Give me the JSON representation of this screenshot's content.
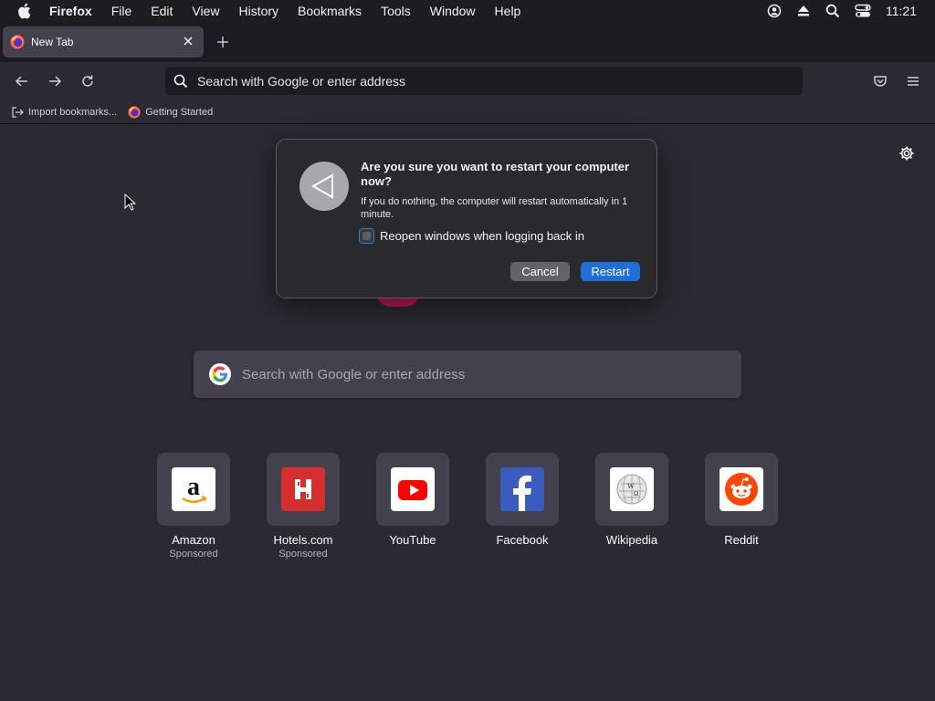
{
  "menubar": {
    "app_name": "Firefox",
    "items": [
      "File",
      "Edit",
      "View",
      "History",
      "Bookmarks",
      "Tools",
      "Window",
      "Help"
    ],
    "clock": "11:21"
  },
  "tabs": {
    "active_title": "New Tab"
  },
  "navbar": {
    "url_placeholder": "Search with Google or enter address"
  },
  "bookmarks": {
    "items": [
      "Import bookmarks...",
      "Getting Started"
    ]
  },
  "newtab": {
    "search_placeholder": "Search with Google or enter address",
    "top_sites": [
      {
        "name": "Amazon",
        "sub": "Sponsored",
        "icon": "amazon-icon"
      },
      {
        "name": "Hotels.com",
        "sub": "Sponsored",
        "icon": "hotels-icon"
      },
      {
        "name": "YouTube",
        "sub": "",
        "icon": "youtube-icon"
      },
      {
        "name": "Facebook",
        "sub": "",
        "icon": "facebook-icon"
      },
      {
        "name": "Wikipedia",
        "sub": "",
        "icon": "wikipedia-icon"
      },
      {
        "name": "Reddit",
        "sub": "",
        "icon": "reddit-icon"
      }
    ]
  },
  "dialog": {
    "title": "Are you sure you want to restart your computer now?",
    "message": "If you do nothing, the computer will restart automatically in 1 minute.",
    "checkbox_label": "Reopen windows when logging back in",
    "cancel_label": "Cancel",
    "restart_label": "Restart"
  },
  "colors": {
    "accent": "#1f6fd6",
    "background": "#2b2a33",
    "tile": "#42414d"
  }
}
